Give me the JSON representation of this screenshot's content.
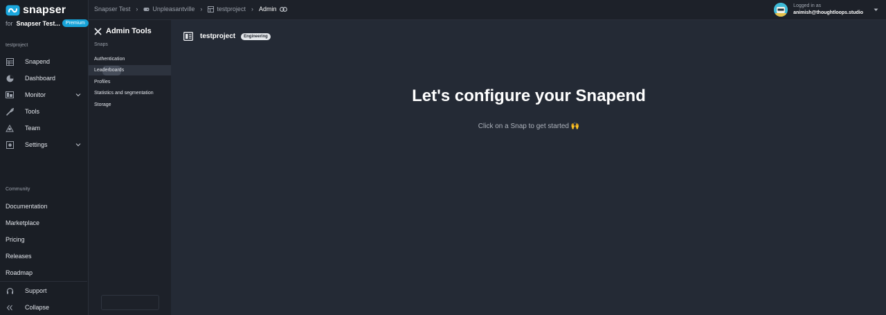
{
  "brand": {
    "name": "snapser"
  },
  "org": {
    "prefix": "for",
    "name": "Snapser Test...",
    "plan_badge": "Premium"
  },
  "sidebar": {
    "project_label": "testproject",
    "items": [
      {
        "label": "Snapend",
        "icon": "grid-icon"
      },
      {
        "label": "Dashboard",
        "icon": "pie-chart-icon"
      },
      {
        "label": "Monitor",
        "icon": "monitor-icon",
        "expandable": true
      },
      {
        "label": "Tools",
        "icon": "wrench-icon"
      },
      {
        "label": "Team",
        "icon": "team-icon"
      },
      {
        "label": "Settings",
        "icon": "settings-icon",
        "expandable": true
      }
    ],
    "community_label": "Community",
    "community_links": [
      "Documentation",
      "Marketplace",
      "Pricing",
      "Releases",
      "Roadmap"
    ],
    "support_label": "Support",
    "collapse_label": "Collapse"
  },
  "breadcrumb": {
    "items": [
      "Snapser Test",
      "Unpleasantville",
      "testproject",
      "Admin"
    ]
  },
  "user": {
    "caption": "Logged in as",
    "email": "animish@thoughtloops.studio"
  },
  "admin_panel": {
    "title": "Admin Tools",
    "section": "Snaps",
    "items": [
      "Authentication",
      "Leaderboards",
      "Profiles",
      "Statistics and segmentation",
      "Storage"
    ],
    "active_index": 1
  },
  "main": {
    "project_name": "testproject",
    "project_badge": "Engineering",
    "headline": "Let's configure your Snapend",
    "subline": "Click on a Snap to get started 🙌"
  },
  "colors": {
    "accent": "#16a3d9",
    "background": "#242a35",
    "sidebar": "#1a1e25"
  }
}
